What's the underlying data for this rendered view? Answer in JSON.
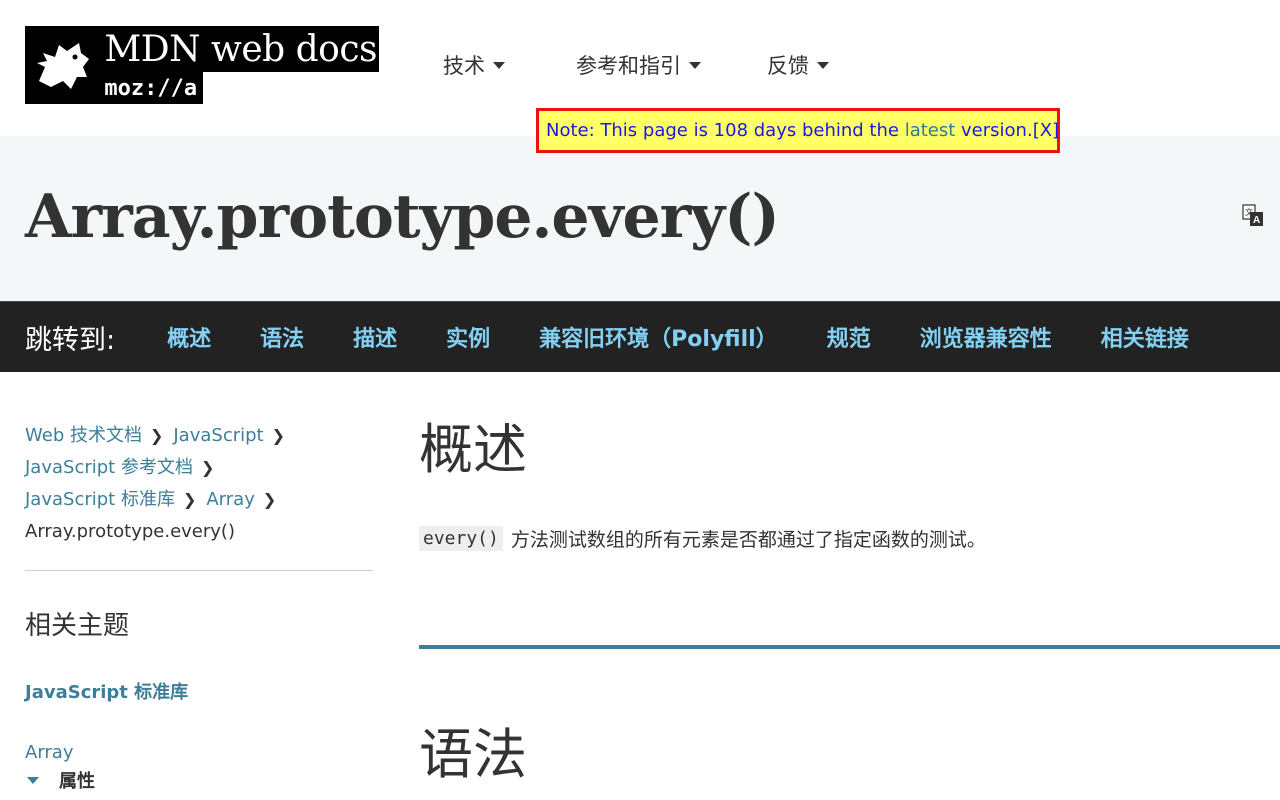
{
  "header": {
    "logo": {
      "title": "MDN web docs",
      "subtitle": "moz://a"
    },
    "nav": [
      {
        "label": "技术"
      },
      {
        "label": "参考和指引"
      },
      {
        "label": "反馈"
      }
    ]
  },
  "note": {
    "prefix": "Note: This page is 108 days behind the ",
    "link": "latest",
    "suffix": " version.",
    "close": "[X]"
  },
  "page": {
    "title": "Array.prototype.every()",
    "lang_icon": "translate-icon"
  },
  "jump": {
    "label": "跳转到:",
    "links": [
      "概述",
      "语法",
      "描述",
      "实例",
      "兼容旧环境（Polyfill）",
      "规范",
      "浏览器兼容性",
      "相关链接"
    ]
  },
  "sidebar": {
    "breadcrumbs": [
      "Web 技术文档",
      "JavaScript",
      "JavaScript 参考文档",
      "JavaScript 标准库",
      "Array"
    ],
    "current": "Array.prototype.every()",
    "related_title": "相关主题",
    "std_lib": "JavaScript 标准库",
    "array": "Array",
    "properties": "属性"
  },
  "content": {
    "overview_heading": "概述",
    "summary_code": "every()",
    "summary_text": "方法测试数组的所有元素是否都通过了指定函数的测试。",
    "syntax_heading": "语法"
  },
  "colors": {
    "link": "#3d7e9a",
    "jump_link": "#83d0f2",
    "note_bg": "#ffff66",
    "note_border": "#ee1111",
    "jump_bg": "#222222"
  }
}
